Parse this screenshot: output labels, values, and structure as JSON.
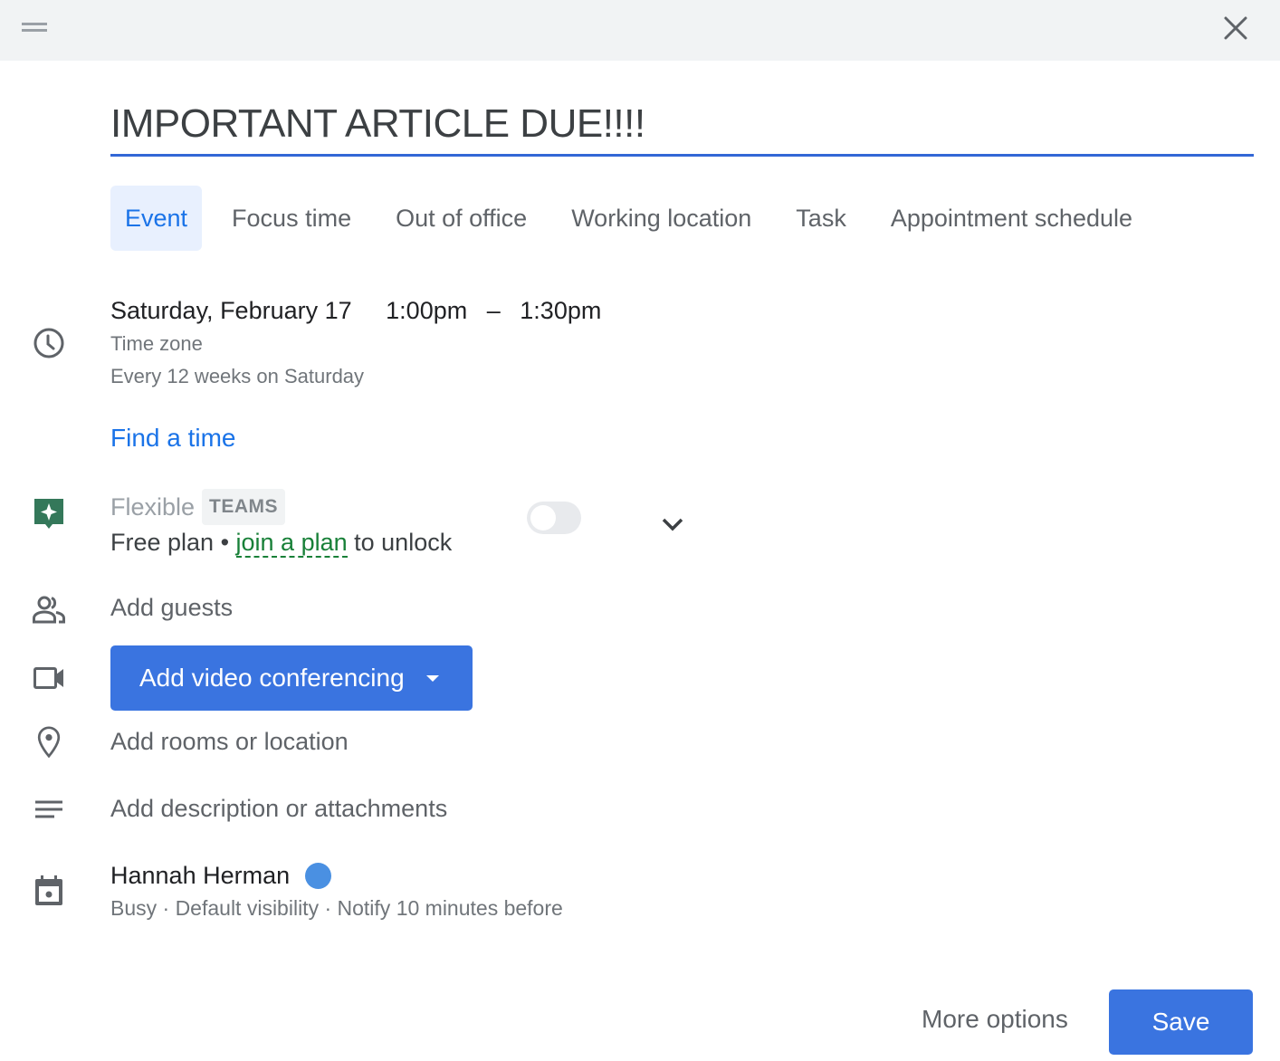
{
  "header": {
    "drag_handle_icon": "drag-handle-icon",
    "close_icon": "close-icon"
  },
  "title": {
    "value": "IMPORTANT ARTICLE DUE!!!!"
  },
  "tabs": [
    {
      "label": "Event",
      "active": true
    },
    {
      "label": "Focus time",
      "active": false
    },
    {
      "label": "Out of office",
      "active": false
    },
    {
      "label": "Working location",
      "active": false
    },
    {
      "label": "Task",
      "active": false
    },
    {
      "label": "Appointment schedule",
      "active": false
    }
  ],
  "schedule": {
    "date": "Saturday, February 17",
    "start_time": "1:00pm",
    "separator": "–",
    "end_time": "1:30pm",
    "time_zone": "Time zone",
    "recurrence": "Every 12 weeks on Saturday",
    "find_time": "Find a time"
  },
  "flexible": {
    "label": "Flexible",
    "badge": "TEAMS",
    "plan_prefix": "Free plan • ",
    "plan_link": "join a plan",
    "plan_suffix": " to unlock",
    "toggle_on": false,
    "accent_color": "#34785a"
  },
  "guests": {
    "placeholder": "Add guests"
  },
  "video": {
    "label": "Add video conferencing"
  },
  "location": {
    "placeholder": "Add rooms or location"
  },
  "description": {
    "placeholder": "Add description or attachments"
  },
  "calendar": {
    "owner": "Hannah Herman",
    "color": "#4a90e2",
    "details": "Busy · Default visibility · Notify 10 minutes before"
  },
  "footer": {
    "more_options": "More options",
    "save": "Save"
  }
}
